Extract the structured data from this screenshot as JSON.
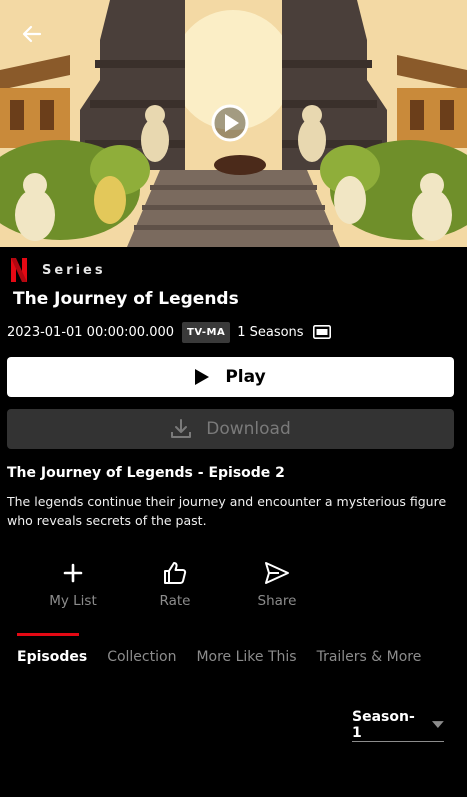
{
  "hero": {
    "back_icon": "arrow-left-icon",
    "play_icon": "play-circle-icon"
  },
  "brand": {
    "logo_icon": "netflix-n-logo",
    "accent_color": "#e50914"
  },
  "show": {
    "type_label": "Series",
    "title": "The Journey of Legends",
    "release": "2023-01-01 00:00:00.000",
    "rating": "TV-MA",
    "seasons": "1 Seasons",
    "hd_icon": "hd-icon"
  },
  "buttons": {
    "play_label": "Play",
    "download_label": "Download"
  },
  "episode": {
    "title": "The Journey of Legends - Episode 2",
    "description": "The legends continue their journey and encounter a mysterious figure who reveals secrets of the past."
  },
  "actions": [
    {
      "label": "My List",
      "icon": "plus-icon"
    },
    {
      "label": "Rate",
      "icon": "thumbs-up-icon"
    },
    {
      "label": "Share",
      "icon": "send-icon"
    }
  ],
  "tabs": [
    {
      "label": "Episodes",
      "active": true
    },
    {
      "label": "Collection",
      "active": false
    },
    {
      "label": "More Like This",
      "active": false
    },
    {
      "label": "Trailers & More",
      "active": false
    }
  ],
  "season_select": {
    "value": "Season-1"
  }
}
